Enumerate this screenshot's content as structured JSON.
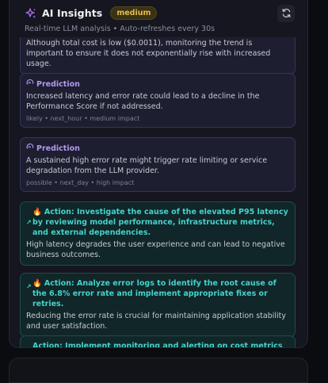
{
  "header": {
    "title": "AI Insights",
    "badge": "medium",
    "subtitle": "Real-time LLM analysis • Auto-refreshes every 30s",
    "icons": {
      "title": "sparkles-icon",
      "refresh": "refresh-icon"
    }
  },
  "colors": {
    "accent_purple": "#b597f0",
    "accent_teal": "#45d2cc",
    "badge_text": "#e7bd4a",
    "panel_bg": "#15161f"
  },
  "insights": {
    "top_partial_text": "Although total cost is low ($0.0011), monitoring the trend is important to ensure it does not exponentially rise with increased usage.",
    "predictions": [
      {
        "label": "Prediction",
        "text": "Increased latency and error rate could lead to a decline in the Performance Score if not addressed.",
        "meta": "likely • next_hour • medium impact"
      },
      {
        "label": "Prediction",
        "text": "A sustained high error rate might trigger rate limiting or service degradation from the LLM provider.",
        "meta": "possible • next_day • high impact"
      }
    ],
    "actions": [
      {
        "title": "Action: Investigate the cause of the elevated P95 latency by reviewing model performance, infrastructure metrics, and external dependencies.",
        "text": "High latency degrades the user experience and can lead to negative business outcomes."
      },
      {
        "title": "Action: Analyze error logs to identify the root cause of the 6.8% error rate and implement appropriate fixes or retries.",
        "text": "Reducing the error rate is crucial for maintaining application stability and user satisfaction."
      },
      {
        "title": "Action: Implement monitoring and alerting on cost metrics to",
        "text": ""
      }
    ]
  }
}
